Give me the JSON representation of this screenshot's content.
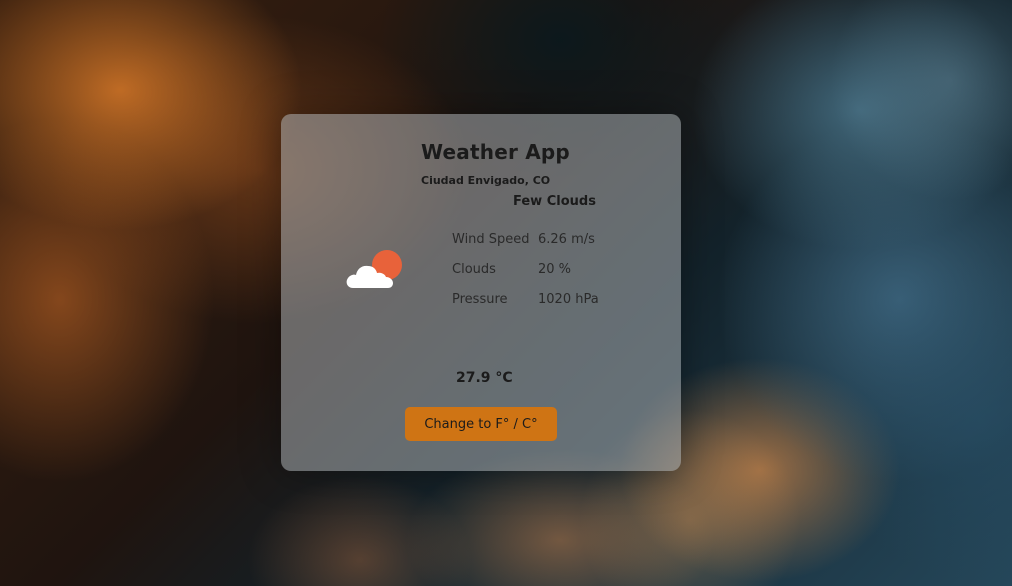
{
  "app": {
    "title": "Weather App",
    "city": "Ciudad Envigado, CO",
    "description": "Few Clouds"
  },
  "details": [
    {
      "label": "Wind Speed",
      "value": "6.26 m/s"
    },
    {
      "label": "Clouds",
      "value": "20 %"
    },
    {
      "label": "Pressure",
      "value": "1020 hPa"
    }
  ],
  "temperature": "27.9 °C",
  "toggle_button_label": "Change to F° / C°",
  "icon": {
    "name": "few-clouds-icon",
    "sun_color": "#e8623a",
    "cloud_color": "#ffffff"
  },
  "colors": {
    "button": "#cf7414",
    "card": "rgba(170,175,178,0.55)"
  }
}
